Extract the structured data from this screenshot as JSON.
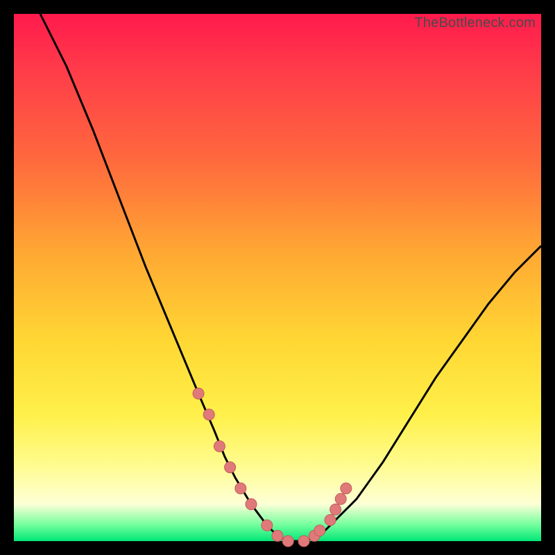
{
  "watermark": "TheBottleneck.com",
  "colors": {
    "frame": "#000000",
    "grad_top": "#ff1a4c",
    "grad_mid1": "#ff6a3d",
    "grad_mid2": "#ffd733",
    "grad_low": "#fffb8a",
    "grad_bottom": "#00e676",
    "curve": "#000000",
    "dot_fill": "#e07a7a",
    "dot_stroke": "#c45a5a"
  },
  "chart_data": {
    "type": "line",
    "title": "",
    "xlabel": "",
    "ylabel": "",
    "xlim": [
      0,
      100
    ],
    "ylim": [
      0,
      100
    ],
    "series": [
      {
        "name": "bottleneck-curve",
        "x": [
          5,
          10,
          15,
          20,
          25,
          30,
          35,
          38,
          40,
          42,
          45,
          48,
          50,
          52,
          55,
          58,
          60,
          65,
          70,
          75,
          80,
          85,
          90,
          95,
          100
        ],
        "y": [
          100,
          90,
          78,
          65,
          52,
          40,
          28,
          21,
          16,
          12,
          7,
          3,
          1,
          0,
          0,
          1,
          3,
          8,
          15,
          23,
          31,
          38,
          45,
          51,
          56
        ]
      }
    ],
    "markers": {
      "name": "highlighted-points",
      "x": [
        35,
        37,
        39,
        41,
        43,
        45,
        48,
        50,
        52,
        55,
        57,
        58,
        60,
        61,
        62,
        63
      ],
      "y": [
        28,
        24,
        18,
        14,
        10,
        7,
        3,
        1,
        0,
        0,
        1,
        2,
        4,
        6,
        8,
        10
      ]
    }
  }
}
